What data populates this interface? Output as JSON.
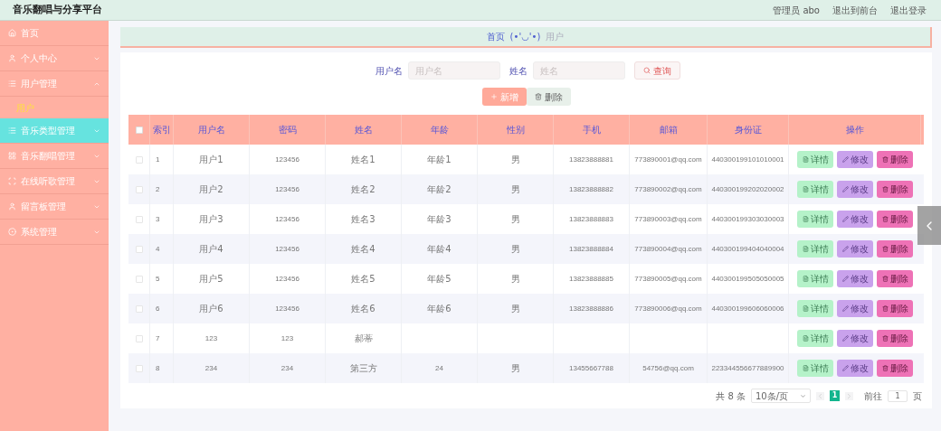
{
  "header": {
    "title": "音乐翻唱与分享平台",
    "links": [
      "管理员 abo",
      "退出到前台",
      "退出登录"
    ]
  },
  "sidebar": {
    "items": [
      {
        "label": "首页",
        "selected": false
      },
      {
        "label": "个人中心",
        "selected": false,
        "expanded": false
      },
      {
        "label": "用户管理",
        "selected": false,
        "expanded": true,
        "children": [
          {
            "label": "用户",
            "selected": true
          }
        ]
      },
      {
        "label": "音乐类型管理",
        "selected": true,
        "expanded": false
      },
      {
        "label": "音乐翻唱管理",
        "selected": false,
        "expanded": false
      },
      {
        "label": "在线听歌管理",
        "selected": false,
        "expanded": false
      },
      {
        "label": "留言板管理",
        "selected": false,
        "expanded": false
      },
      {
        "label": "系统管理",
        "selected": false,
        "expanded": false
      }
    ]
  },
  "breadcrumb": {
    "home": "首页",
    "separator": "(•'◡'•)",
    "current": "用户"
  },
  "search": {
    "fields": [
      {
        "label": "用户名",
        "placeholder": "用户名"
      },
      {
        "label": "姓名",
        "placeholder": "姓名"
      }
    ],
    "button": "查询"
  },
  "actions": [
    {
      "kind": "add",
      "label": "新增"
    },
    {
      "kind": "delete",
      "label": "删除"
    }
  ],
  "table": {
    "columns": [
      "索引",
      "用户名",
      "密码",
      "姓名",
      "年龄",
      "性别",
      "手机",
      "邮箱",
      "身份证",
      "操作"
    ],
    "header_checked": false,
    "rows": [
      {
        "checked": false,
        "cells": [
          "1",
          "用户1",
          "123456",
          "姓名1",
          "年龄1",
          "男",
          "13823888881",
          "773890001@qq.com",
          "440300199101010001"
        ],
        "actions": [
          {
            "kind": "detail",
            "label": "详情"
          },
          {
            "kind": "edit",
            "label": "修改"
          },
          {
            "kind": "delete",
            "label": "删除"
          }
        ]
      },
      {
        "checked": false,
        "cells": [
          "2",
          "用户2",
          "123456",
          "姓名2",
          "年龄2",
          "男",
          "13823888882",
          "773890002@qq.com",
          "440300199202020002"
        ],
        "actions": [
          {
            "kind": "detail",
            "label": "详情"
          },
          {
            "kind": "edit",
            "label": "修改"
          },
          {
            "kind": "delete",
            "label": "删除"
          }
        ]
      },
      {
        "checked": false,
        "cells": [
          "3",
          "用户3",
          "123456",
          "姓名3",
          "年龄3",
          "男",
          "13823888883",
          "773890003@qq.com",
          "440300199303030003"
        ],
        "actions": [
          {
            "kind": "detail",
            "label": "详情"
          },
          {
            "kind": "edit",
            "label": "修改"
          },
          {
            "kind": "delete",
            "label": "删除"
          }
        ]
      },
      {
        "checked": false,
        "cells": [
          "4",
          "用户4",
          "123456",
          "姓名4",
          "年龄4",
          "男",
          "13823888884",
          "773890004@qq.com",
          "440300199404040004"
        ],
        "actions": [
          {
            "kind": "detail",
            "label": "详情"
          },
          {
            "kind": "edit",
            "label": "修改"
          },
          {
            "kind": "delete",
            "label": "删除"
          }
        ]
      },
      {
        "checked": false,
        "cells": [
          "5",
          "用户5",
          "123456",
          "姓名5",
          "年龄5",
          "男",
          "13823888885",
          "773890005@qq.com",
          "440300199505050005"
        ],
        "actions": [
          {
            "kind": "detail",
            "label": "详情"
          },
          {
            "kind": "edit",
            "label": "修改"
          },
          {
            "kind": "delete",
            "label": "删除"
          }
        ]
      },
      {
        "checked": false,
        "cells": [
          "6",
          "用户6",
          "123456",
          "姓名6",
          "年龄6",
          "男",
          "13823888886",
          "773890006@qq.com",
          "440300199606060006"
        ],
        "actions": [
          {
            "kind": "detail",
            "label": "详情"
          },
          {
            "kind": "edit",
            "label": "修改"
          },
          {
            "kind": "delete",
            "label": "删除"
          }
        ]
      },
      {
        "checked": false,
        "cells": [
          "7",
          "123",
          "123",
          "郝蒂",
          "",
          "",
          "",
          "",
          ""
        ],
        "actions": [
          {
            "kind": "detail",
            "label": "详情"
          },
          {
            "kind": "edit",
            "label": "修改"
          },
          {
            "kind": "delete",
            "label": "删除"
          }
        ]
      },
      {
        "checked": false,
        "cells": [
          "8",
          "234",
          "234",
          "第三方",
          "24",
          "男",
          "13455667788",
          "54756@qq.com",
          "223344556677889900"
        ],
        "actions": [
          {
            "kind": "detail",
            "label": "详情"
          },
          {
            "kind": "edit",
            "label": "修改"
          },
          {
            "kind": "delete",
            "label": "删除"
          }
        ]
      }
    ]
  },
  "pagination": {
    "total": "共 8 条",
    "page_size": "10条/页",
    "pages": [
      {
        "label": "1",
        "selected": true
      }
    ],
    "goto_label": "前往",
    "goto_value": "1",
    "goto_suffix": "页"
  }
}
